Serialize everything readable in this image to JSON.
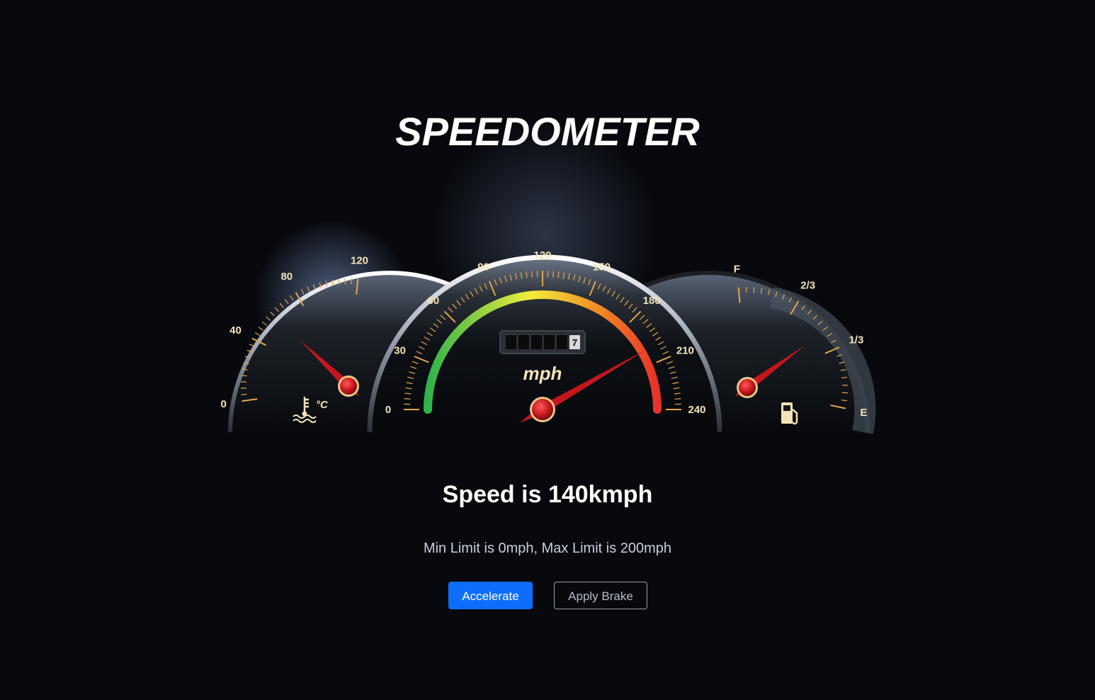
{
  "page": {
    "title": "SPEEDOMETER"
  },
  "status": {
    "speed_text": "Speed is 140kmph",
    "limit_text": "Min Limit is 0mph, Max Limit is 200mph"
  },
  "controls": {
    "accelerate_label": "Accelerate",
    "brake_label": "Apply Brake"
  },
  "gauges": {
    "temperature": {
      "ticks": [
        "0",
        "40",
        "80",
        "120"
      ],
      "unit_symbol": "°C",
      "icon": "coolant-temperature-icon",
      "needle_value": 60
    },
    "speed": {
      "ticks": [
        "0",
        "30",
        "60",
        "90",
        "120",
        "150",
        "180",
        "210",
        "240"
      ],
      "unit": "mph",
      "odometer": [
        "",
        "",
        "",
        "",
        "",
        "7"
      ],
      "needle_value": 200,
      "arc_colors": [
        "#2fb34a",
        "#f2ec3c",
        "#f08a24",
        "#e8312a"
      ]
    },
    "fuel": {
      "ticks": [
        "F",
        "2/3",
        "1/3",
        "E"
      ],
      "icon": "fuel-pump-icon",
      "needle_level": 0.45
    }
  },
  "colors": {
    "background": "#07090e",
    "accent": "#0d6efd",
    "needle": "#c4161c",
    "tick": "#e6a54a",
    "label": "#f3e3b8"
  }
}
